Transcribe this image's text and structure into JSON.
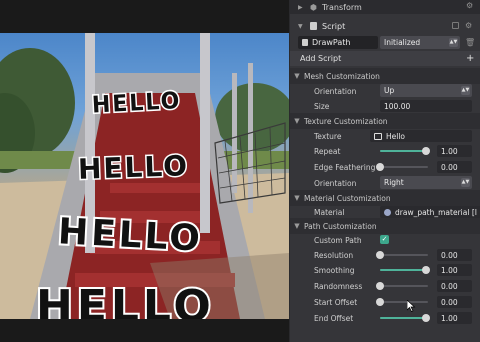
{
  "inspector": {
    "transform_label": "Transform",
    "script_label": "Script",
    "component_name": "DrawPath",
    "component_state": "Initialized",
    "add_script_label": "Add Script",
    "add_icon": "+"
  },
  "sections": {
    "mesh": {
      "title": "Mesh Customization",
      "orientation_label": "Orientation",
      "orientation_value": "Up",
      "size_label": "Size",
      "size_value": "100.00"
    },
    "texture": {
      "title": "Texture Customization",
      "texture_label": "Texture",
      "texture_value": "Hello",
      "repeat_label": "Repeat",
      "repeat_value": "1.00",
      "repeat_fraction": 0.95,
      "feather_label": "Edge Feathering",
      "feather_value": "0.00",
      "feather_fraction": 0.0,
      "orientation_label": "Orientation",
      "orientation_value": "Right"
    },
    "material": {
      "title": "Material Customization",
      "material_label": "Material",
      "material_value": "draw_path_material [I"
    },
    "path": {
      "title": "Path Customization",
      "custom_path_label": "Custom Path",
      "custom_path_checked": true,
      "resolution_label": "Resolution",
      "resolution_value": "0.00",
      "resolution_fraction": 0.0,
      "smoothing_label": "Smoothing",
      "smoothing_value": "1.00",
      "smoothing_fraction": 0.95,
      "randomness_label": "Randomness",
      "randomness_value": "0.00",
      "randomness_fraction": 0.0,
      "start_offset_label": "Start Offset",
      "start_offset_value": "0.00",
      "start_offset_fraction": 0.0,
      "end_offset_label": "End Offset",
      "end_offset_value": "1.00",
      "end_offset_fraction": 0.95
    }
  },
  "preview": {
    "path_text": "HELLO"
  },
  "colors": {
    "accent": "#4fb39a",
    "panel": "#353539",
    "section_header": "#2e2e32"
  }
}
